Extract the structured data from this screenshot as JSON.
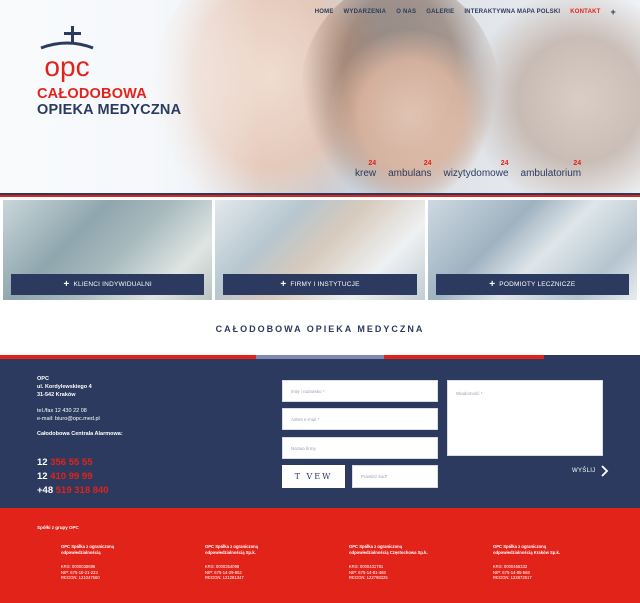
{
  "nav": {
    "items": [
      "HOME",
      "WYDARZENIA",
      "O NAS",
      "GALERIE",
      "INTERAKTYWNA MAPA POLSKI",
      "KONTAKT"
    ],
    "active_index": 5,
    "plus": "+"
  },
  "logo": {
    "text": "opc"
  },
  "brand": {
    "line1": "CAŁODOBOWA",
    "line2": "OPIEKA MEDYCZNA"
  },
  "services": [
    {
      "label": "krew",
      "num": "24"
    },
    {
      "label": "ambulans",
      "num": "24"
    },
    {
      "label": "wizytydomowe",
      "num": "24"
    },
    {
      "label": "ambulatorium",
      "num": "24"
    }
  ],
  "tiles": [
    {
      "label": "KLIENCI INDYWIDUALNI",
      "plus": "+"
    },
    {
      "label": "FIRMY I INSTYTUCJE",
      "plus": "+"
    },
    {
      "label": "PODMIOTY LECZNICZE",
      "plus": "+"
    }
  ],
  "section": {
    "title": "CAŁODOBOWA OPIEKA MEDYCZNA"
  },
  "contact": {
    "company": "OPC",
    "street": "ul. Kordylewskiego 4",
    "city": "31-542 Kraków",
    "tel": "tel./fax 12 430 22 08",
    "email": "e-mail: biuro@opc.med.pl",
    "alarm_title": "Całodobowa Centrala Alarmowa:",
    "phones": [
      {
        "prefix": "12",
        "number": "356 55 55"
      },
      {
        "prefix": "12",
        "number": "410 99 99"
      },
      {
        "prefix": "+48",
        "number": "519 318 840"
      }
    ]
  },
  "form": {
    "name_placeholder": "Imię i nazwisko *",
    "email_placeholder": "Adres e-mail *",
    "company_placeholder": "Nazwa firmy",
    "message_placeholder": "Wiadomość *",
    "captcha_text": "T VEW",
    "captcha_placeholder": "Powtórz kod*",
    "send_label": "WYŚLIJ",
    "send_icon": "chevron-right-icon"
  },
  "footer": {
    "group_title": "Spółki z grupy OPC",
    "companies": [
      {
        "name1": "OPC Spółka z ograniczoną",
        "name2": "odpowiedzialnością",
        "krs": "KRS: 0000038696",
        "nip": "NIP: 675-10-21-223",
        "regon": "REGON: 121047560"
      },
      {
        "name1": "OPC Spółka z ograniczoną",
        "name2": "odpowiedzialnością Sp.k.",
        "krs": "KRS: 0000354098",
        "nip": "NIP: 675-14-29-652",
        "regon": "REGON: 121281347"
      },
      {
        "name1": "OPC Spółka z ograniczoną",
        "name2": "odpowiedzialnością Częstochowa Sp.k.",
        "krs": "KRS: 0000431781",
        "nip": "NIP: 675-14-81-468",
        "regon": "REGON: 122798325"
      },
      {
        "name1": "OPC Spółka z ograniczoną",
        "name2": "odpowiedzialnością Kraków Sp.k.",
        "krs": "KRS: 0000465332",
        "nip": "NIP: 675-14-85-568",
        "regon": "REGON: 122872917"
      }
    ]
  },
  "colors": {
    "navy": "#2b3a5e",
    "red": "#e2231a"
  }
}
